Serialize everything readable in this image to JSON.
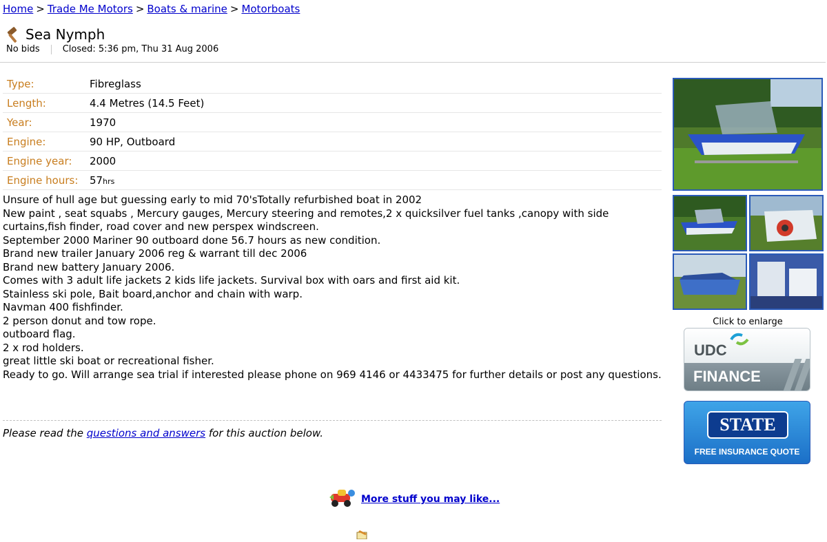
{
  "breadcrumb": {
    "items": [
      "Home",
      "Trade Me Motors",
      "Boats & marine",
      "Motorboats"
    ],
    "separator": ">"
  },
  "listing": {
    "title": "Sea Nymph",
    "bids": "No bids",
    "closed": "Closed: 5:36 pm, Thu 31 Aug 2006"
  },
  "attributes": [
    {
      "label": "Type:",
      "value": "Fibreglass"
    },
    {
      "label": "Length:",
      "value": "4.4 Metres (14.5 Feet)"
    },
    {
      "label": "Year:",
      "value": "1970"
    },
    {
      "label": "Engine:",
      "value": "90 HP, Outboard"
    },
    {
      "label": "Engine year:",
      "value": "2000"
    },
    {
      "label": "Engine hours:",
      "value": "57",
      "unit": "hrs"
    }
  ],
  "description": [
    "Unsure of hull age but guessing early to mid 70'sTotally refurbished boat in 2002",
    "New paint , seat squabs , Mercury gauges, Mercury steering and remotes,2 x quicksilver fuel tanks ,canopy with side curtains,fish finder, road cover and new perspex windscreen.",
    "September 2000 Mariner 90 outboard done 56.7 hours as new condition.",
    "Brand new trailer January 2006 reg & warrant till dec 2006",
    "Brand new battery January 2006.",
    "Comes with 3 adult life jackets 2 kids life jackets. Survival box with oars and first aid kit.",
    "Stainless ski pole, Bait board,anchor and chain with warp.",
    "Navman 400 fishfinder.",
    "2 person donut and tow rope.",
    "outboard flag.",
    "2 x rod holders.",
    "great little ski boat or recreational fisher.",
    "Ready to go. Will arrange sea trial if interested please phone on 969 4146 or 4433475 for further details or post any questions."
  ],
  "qa": {
    "prefix": "Please read the",
    "link": "questions and answers",
    "suffix": "for this auction below."
  },
  "more": {
    "link": "More stuff you may like..."
  },
  "gallery": {
    "caption": "Click to enlarge"
  },
  "ads": {
    "udc": {
      "brand": "UDC",
      "label": "FINANCE"
    },
    "state": {
      "brand": "STATE",
      "tagline": "FREE INSURANCE QUOTE"
    }
  },
  "colors": {
    "link": "#0000cc",
    "attr_label": "#c87d1e",
    "photo_border": "#2a5ab8"
  }
}
